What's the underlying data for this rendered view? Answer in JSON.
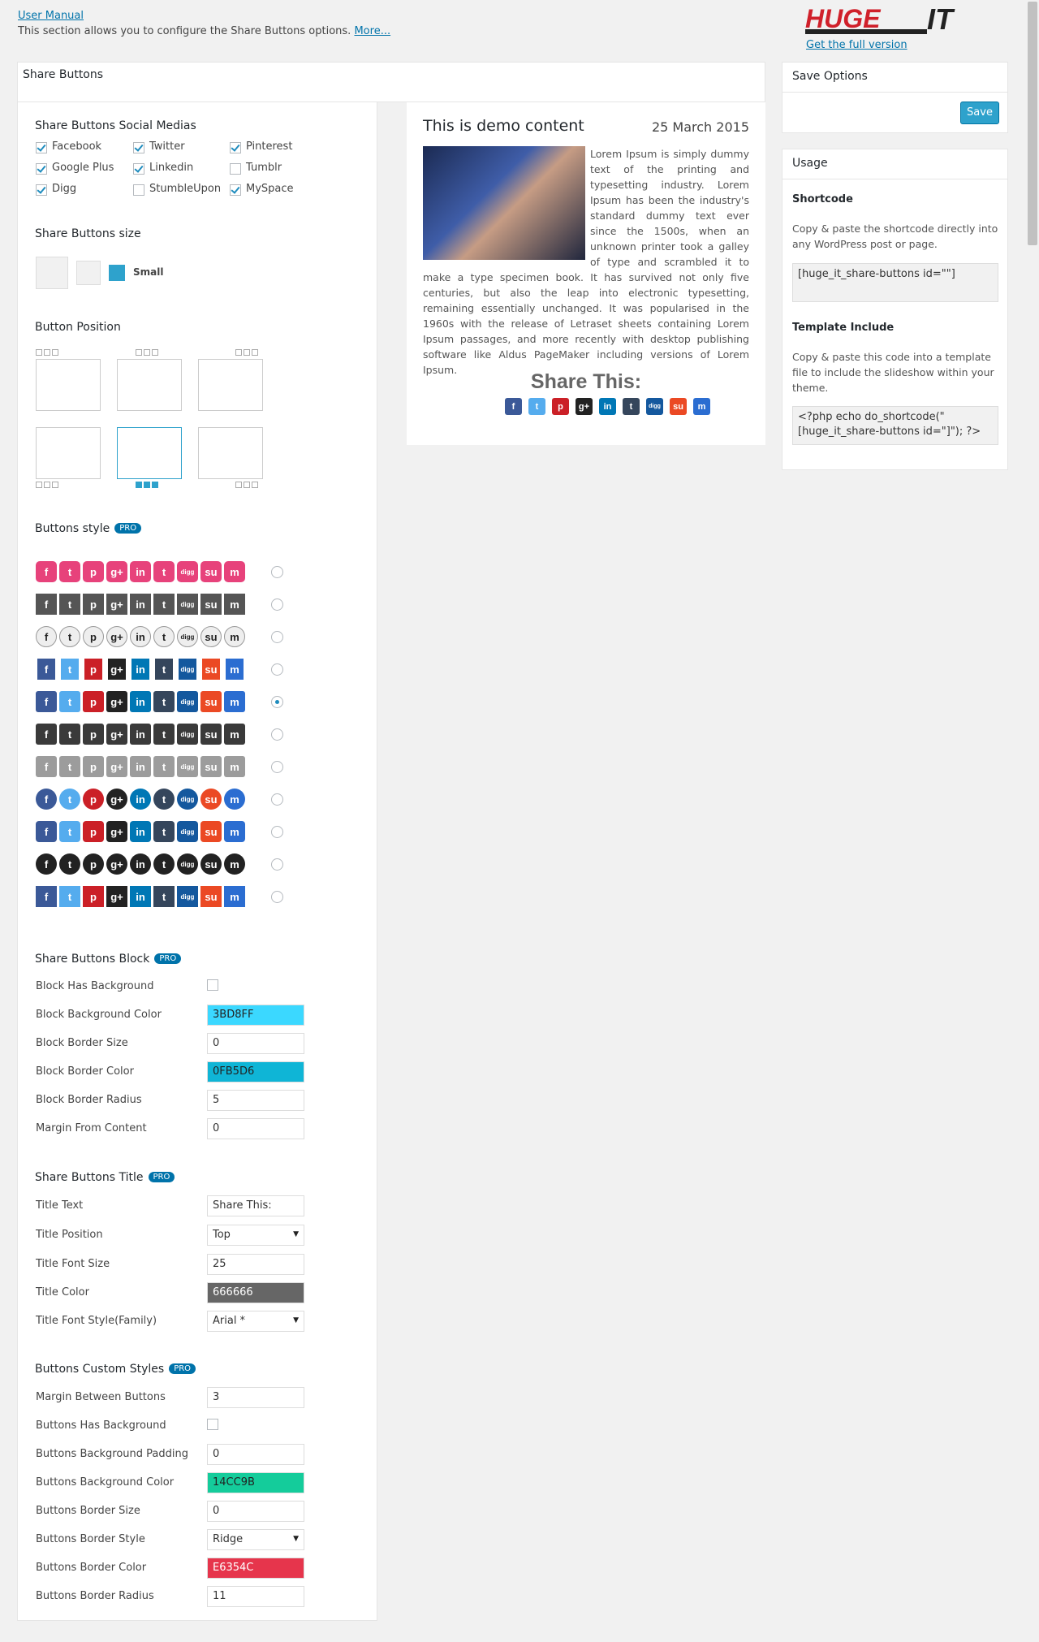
{
  "top": {
    "manual_link": "User Manual",
    "description": "This section allows you to configure the Share Buttons options.",
    "more_link": "More...",
    "full_version_link": "Get the full version"
  },
  "panel_title": "Share Buttons",
  "social": {
    "title": "Share Buttons Social Medias",
    "items": [
      {
        "label": "Facebook",
        "checked": true
      },
      {
        "label": "Twitter",
        "checked": true
      },
      {
        "label": "Pinterest",
        "checked": true
      },
      {
        "label": "Google Plus",
        "checked": true
      },
      {
        "label": "Linkedin",
        "checked": true
      },
      {
        "label": "Tumblr",
        "checked": false
      },
      {
        "label": "Digg",
        "checked": true
      },
      {
        "label": "StumbleUpon",
        "checked": false
      },
      {
        "label": "MySpace",
        "checked": true
      }
    ]
  },
  "size": {
    "title": "Share Buttons size",
    "selected_label": "Small"
  },
  "position": {
    "title": "Button Position",
    "selected_index": 4
  },
  "style": {
    "title": "Buttons style",
    "pro": "PRO",
    "selected_index": 4
  },
  "block": {
    "title": "Share Buttons Block",
    "pro": "PRO",
    "has_background_label": "Block Has Background",
    "bg_color_label": "Block Background Color",
    "bg_color_value": "3BD8FF",
    "bg_color": "#3BD8FF",
    "border_size_label": "Block Border Size",
    "border_size_value": "0",
    "border_color_label": "Block Border Color",
    "border_color_value": "0FB5D6",
    "border_color": "#0FB5D6",
    "border_radius_label": "Block Border Radius",
    "border_radius_value": "5",
    "margin_label": "Margin From Content",
    "margin_value": "0"
  },
  "titleset": {
    "title": "Share Buttons Title",
    "pro": "PRO",
    "text_label": "Title Text",
    "text_value": "Share This:",
    "position_label": "Title Position",
    "position_value": "Top",
    "font_size_label": "Title Font Size",
    "font_size_value": "25",
    "color_label": "Title Color",
    "color_value": "666666",
    "color": "#666666",
    "font_family_label": "Title Font Style(Family)",
    "font_family_value": "Arial *"
  },
  "custom": {
    "title": "Buttons Custom Styles",
    "pro": "PRO",
    "margin_label": "Margin Between Buttons",
    "margin_value": "3",
    "has_bg_label": "Buttons Has Background",
    "bg_padding_label": "Buttons Background Padding",
    "bg_padding_value": "0",
    "bg_color_label": "Buttons Background Color",
    "bg_color_value": "14CC9B",
    "bg_color": "#14CC9B",
    "border_size_label": "Buttons Border Size",
    "border_size_value": "0",
    "border_style_label": "Buttons Border Style",
    "border_style_value": "Ridge",
    "border_color_label": "Buttons Border Color",
    "border_color_value": "E6354C",
    "border_color": "#E6354C",
    "border_radius_label": "Buttons Border Radius",
    "border_radius_value": "11"
  },
  "preview": {
    "title": "This is demo content",
    "date": "25 March 2015",
    "body": "Lorem Ipsum is simply dummy text of the printing and typesetting industry. Lorem Ipsum has been the industry's standard dummy text ever since the 1500s, when an unknown printer took a galley of type and scrambled it to make a type specimen book. It has survived not only five centuries, but also the leap into electronic typesetting, remaining essentially unchanged. It was popularised in the 1960s with the release of Letraset sheets containing Lorem Ipsum passages, and more recently with desktop publishing software like Aldus PageMaker including versions of Lorem Ipsum.",
    "share_title": "Share This:"
  },
  "save": {
    "title": "Save Options",
    "button": "Save"
  },
  "usage": {
    "title": "Usage",
    "shortcode_title": "Shortcode",
    "shortcode_text": "Copy & paste the shortcode directly into any WordPress post or page.",
    "shortcode_value": "[huge_it_share-buttons id=\"\"]",
    "template_title": "Template Include",
    "template_text": "Copy & paste this code into a template file to include the slideshow within your theme.",
    "template_value": "<?php echo do_shortcode(\"[huge_it_share-buttons id=\"]\"); ?>"
  },
  "icons": {
    "letters": [
      "f",
      "t",
      "p",
      "g+",
      "in",
      "t",
      "digg",
      "su",
      "m"
    ],
    "colors": [
      "#3b5998",
      "#55acee",
      "#cb2027",
      "#222222",
      "#0077b5",
      "#35465c",
      "#14589e",
      "#eb4924",
      "#2b6dd1"
    ]
  }
}
